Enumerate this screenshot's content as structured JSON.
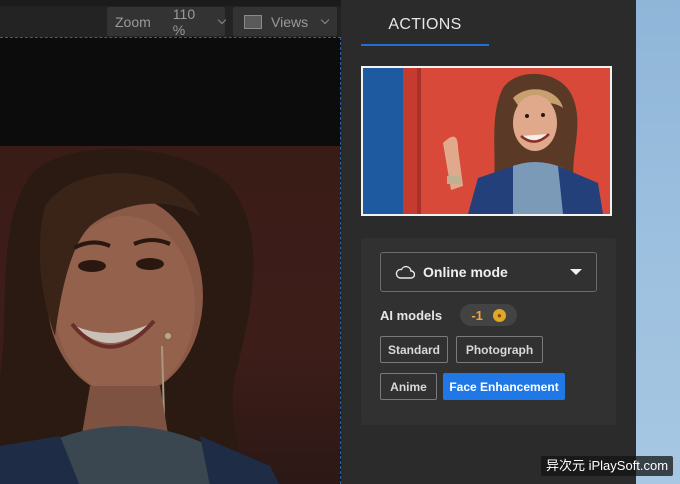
{
  "toolbar": {
    "zoom_label": "Zoom",
    "zoom_value": "110 %",
    "views_label": "Views"
  },
  "panel": {
    "tab_label": "ACTIONS",
    "mode_select": {
      "value": "Online mode",
      "icon": "cloud-icon"
    },
    "ai_models": {
      "label": "AI models",
      "cost": "-1",
      "cost_icon": "coin-icon"
    },
    "model_options": [
      {
        "label": "Standard",
        "selected": false
      },
      {
        "label": "Photograph",
        "selected": false
      },
      {
        "label": "Anime",
        "selected": false
      },
      {
        "label": "Face Enhancement",
        "selected": true
      }
    ]
  },
  "colors": {
    "accent": "#1f78e6",
    "panel_bg": "#2b2b2b",
    "cost_text": "#f1a43a"
  },
  "watermark": "异次元 iPlaySoft.com"
}
